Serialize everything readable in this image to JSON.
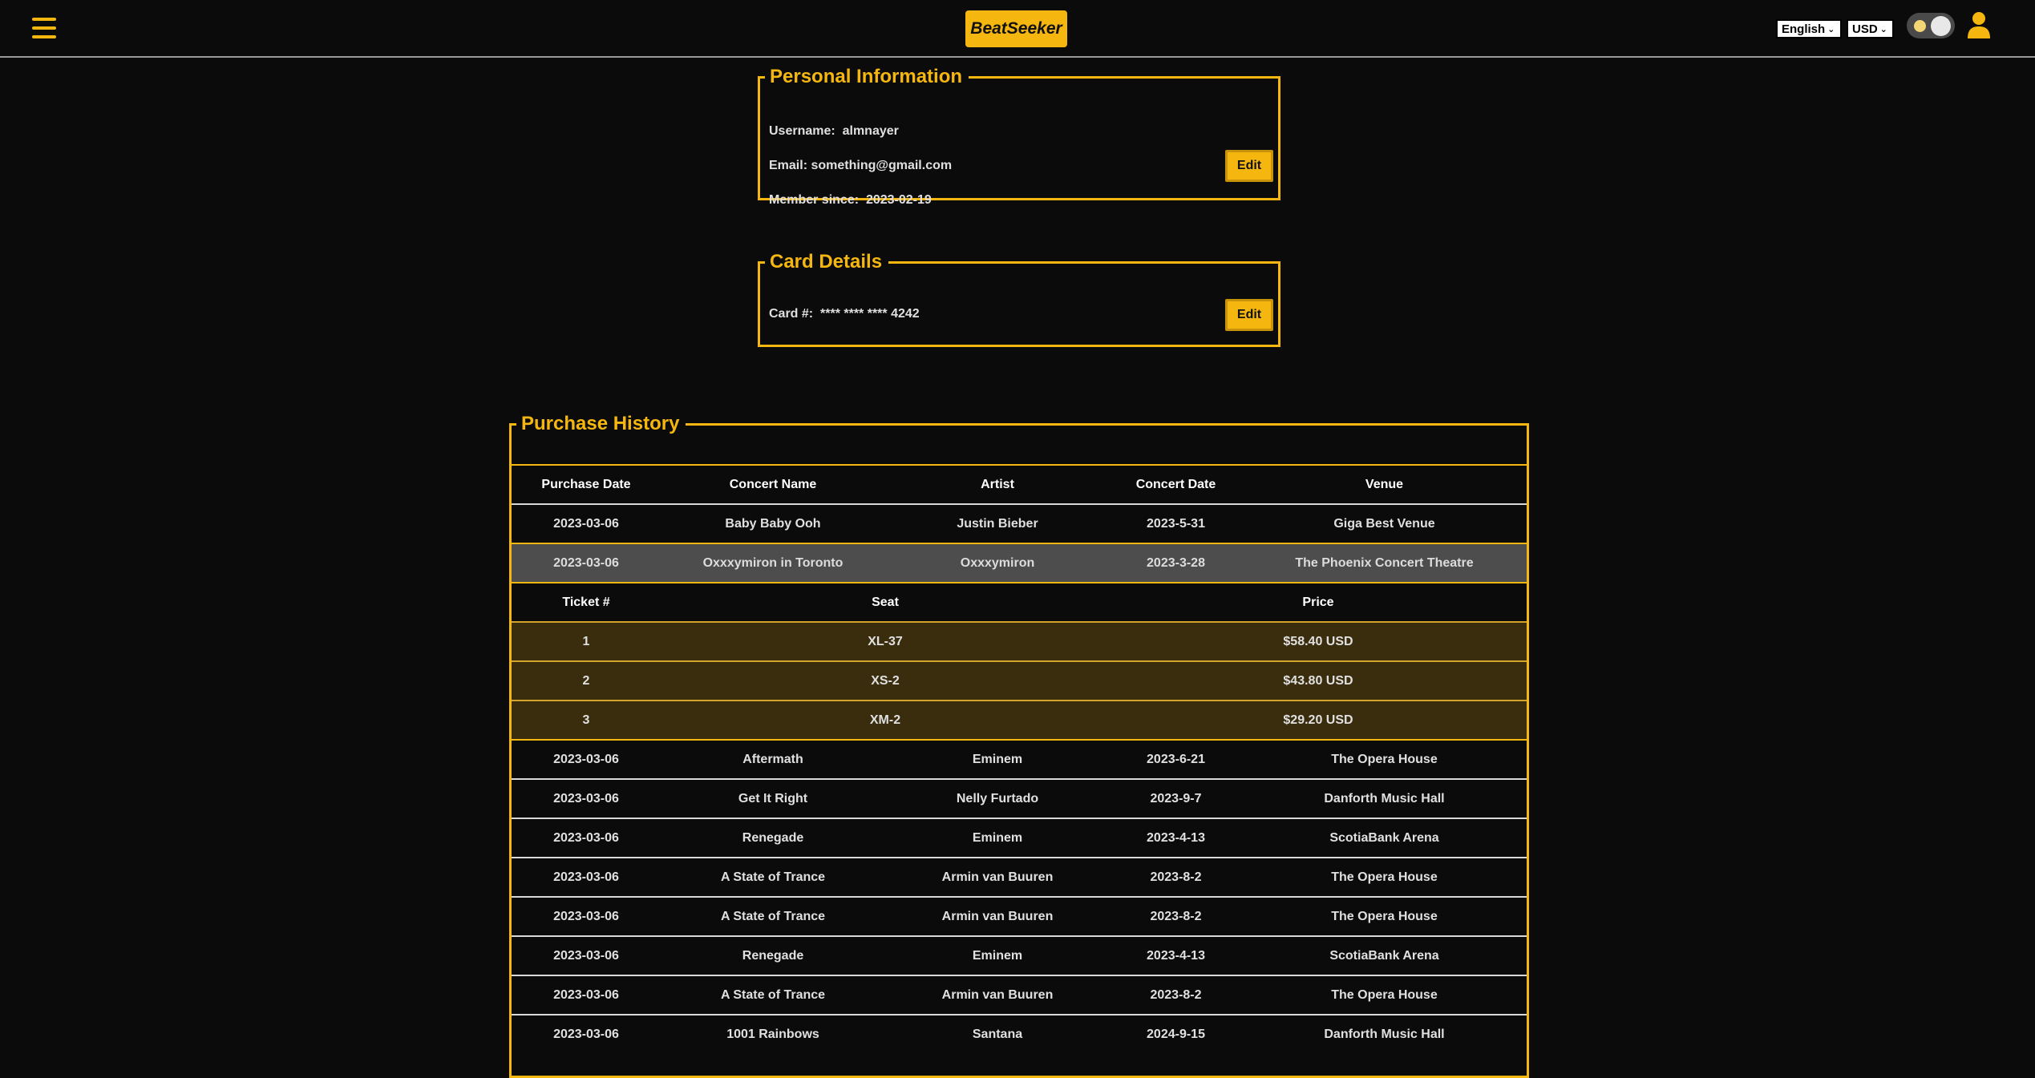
{
  "header": {
    "brand": "BeatSeeker",
    "language": "English",
    "currency": "USD"
  },
  "personal": {
    "title": "Personal Information",
    "username_label": "Username:",
    "username": "almnayer",
    "email_label": "Email:",
    "email": "something@gmail.com",
    "member_label": "Member since:",
    "member_since": "2023-02-19",
    "edit_label": "Edit"
  },
  "card": {
    "title": "Card Details",
    "card_label": "Card #:",
    "card_number": "**** **** **** 4242",
    "edit_label": "Edit"
  },
  "history": {
    "title": "Purchase History",
    "columns": [
      "Purchase Date",
      "Concert Name",
      "Artist",
      "Concert Date",
      "Venue"
    ],
    "rows": [
      [
        "2023-03-06",
        "Baby Baby Ooh",
        "Justin Bieber",
        "2023-5-31",
        "Giga Best Venue"
      ],
      [
        "2023-03-06",
        "Oxxxymiron in Toronto",
        "Oxxxymiron",
        "2023-3-28",
        "The Phoenix Concert Theatre"
      ],
      [
        "2023-03-06",
        "Aftermath",
        "Eminem",
        "2023-6-21",
        "The Opera House"
      ],
      [
        "2023-03-06",
        "Get It Right",
        "Nelly Furtado",
        "2023-9-7",
        "Danforth Music Hall"
      ],
      [
        "2023-03-06",
        "Renegade",
        "Eminem",
        "2023-4-13",
        "ScotiaBank Arena"
      ],
      [
        "2023-03-06",
        "A State of Trance",
        "Armin van Buuren",
        "2023-8-2",
        "The Opera House"
      ],
      [
        "2023-03-06",
        "A State of Trance",
        "Armin van Buuren",
        "2023-8-2",
        "The Opera House"
      ],
      [
        "2023-03-06",
        "Renegade",
        "Eminem",
        "2023-4-13",
        "ScotiaBank Arena"
      ],
      [
        "2023-03-06",
        "A State of Trance",
        "Armin van Buuren",
        "2023-8-2",
        "The Opera House"
      ],
      [
        "2023-03-06",
        "1001 Rainbows",
        "Santana",
        "2024-9-15",
        "Danforth Music Hall"
      ]
    ],
    "ticket_columns": [
      "Ticket #",
      "Seat",
      "Price"
    ],
    "tickets": [
      [
        "1",
        "XL-37",
        "$58.40 USD"
      ],
      [
        "2",
        "XS-2",
        "$43.80 USD"
      ],
      [
        "3",
        "XM-2",
        "$29.20 USD"
      ]
    ]
  },
  "colors": {
    "accent": "#f5b70f",
    "background": "#0b0b0b",
    "selected_row": "#4d4d4d",
    "ticket_row": "#3a2d0e"
  },
  "icons": {
    "menu": "hamburger-menu-icon",
    "user": "user-icon",
    "theme": "theme-toggle"
  }
}
